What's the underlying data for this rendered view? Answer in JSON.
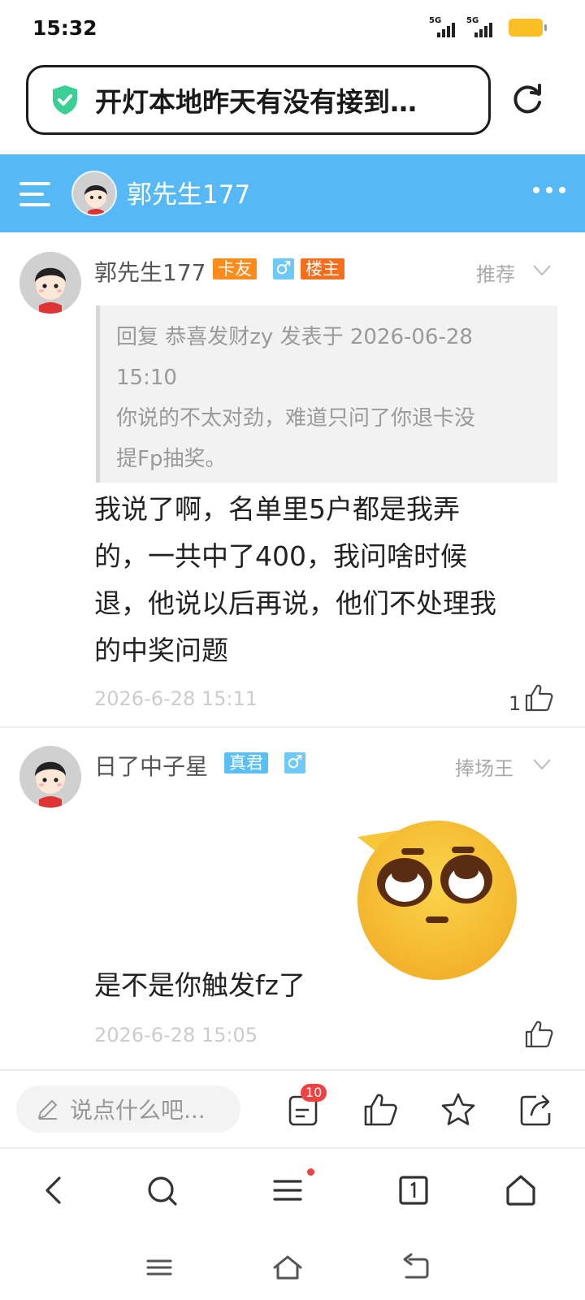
{
  "status": {
    "time": "15:32",
    "signal1": "5G",
    "signal2": "5G"
  },
  "url_bar": {
    "text": "开灯本地昨天有没有接到…"
  },
  "header": {
    "username": "郭先生177"
  },
  "posts": [
    {
      "username": "郭先生177",
      "badges": [
        "卡友",
        "♂",
        "楼主"
      ],
      "tag": "推荐",
      "quote_line1": "回复 恭喜发财zy 发表于 2026-06-28",
      "quote_line2": "15:10",
      "quote_line3": "你说的不太对劲，难道只问了你退卡没",
      "quote_line4": "提Fp抽奖。",
      "content_line1": "我说了啊，名单里5户都是我弄",
      "content_line2": "的，一共中了400，我问啥时候",
      "content_line3": "退，他说以后再说，他们不处理我",
      "content_line4": "的中奖问题",
      "timestamp": "2026-6-28 15:11",
      "likes": "1"
    },
    {
      "username": "日了中子星",
      "badges": [
        "真君",
        "♂"
      ],
      "tag": "捧场王",
      "content": "是不是你触发fz了",
      "timestamp": "2026-6-28 15:05",
      "emoji": "eye-roll-emoji"
    }
  ],
  "action_bar": {
    "placeholder": "说点什么吧...",
    "comment_count": "10"
  },
  "colors": {
    "header": "#56b8f5",
    "badge_orange": "#ff8c1a",
    "badge_blue": "#59c0f5",
    "badge_red": "#f56e1c"
  }
}
